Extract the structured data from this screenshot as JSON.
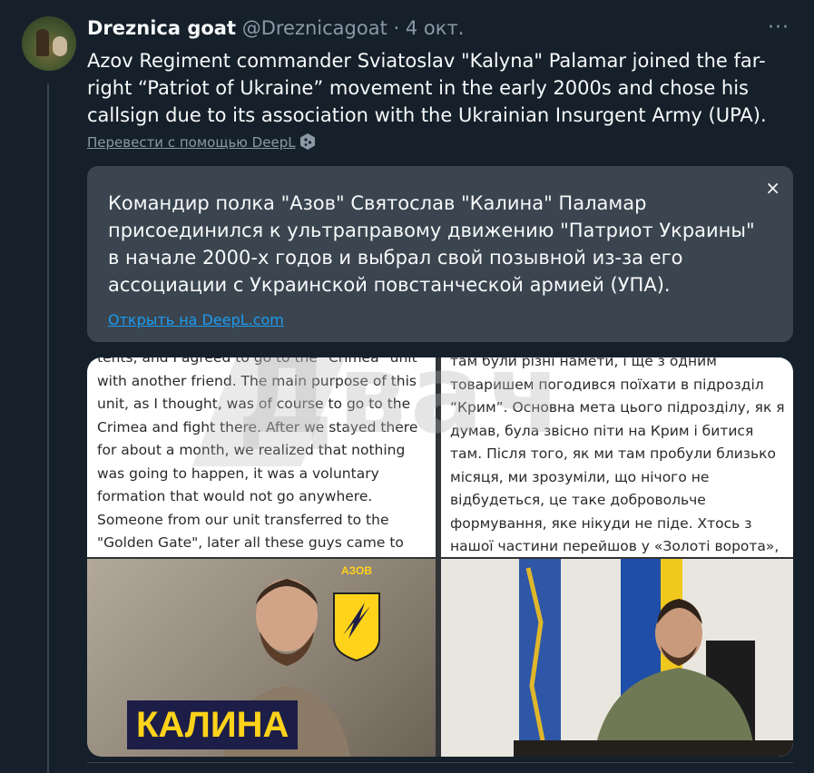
{
  "tweet": {
    "author_name": "Dreznica goat",
    "handle": "@Dreznicagoat",
    "separator": "·",
    "date": "4 окт.",
    "more_label": "···",
    "text": "Azov Regiment commander Sviatoslav \"Kalyna\" Palamar joined the far-right “Patriot of Ukraine” movement in the early 2000s and chose his callsign due to its association with the Ukrainian Insurgent Army (UPA).",
    "translate_label": "Перевести с помощью DeepL"
  },
  "translation": {
    "text": "Командир полка \"Азов\" Святослав \"Калина\" Паламар присоединился к ультраправому движению \"Патриот Украины\" в начале 2000-х годов и выбрал свой позывной из-за его ассоциации с Украинской повстанческой армией (УПА).",
    "close_label": "×",
    "open_label": "Открыть на DeepL.com"
  },
  "media": {
    "watermark": "Двач",
    "doc_en": "tents, and I agreed to go to the \"Crimea\" unit with another friend. The main purpose of this unit, as I thought, was of course to go to the Crimea and fight there. After we stayed there for about a month, we realized that nothing was going to happen, it was a voluntary formation that would not go anywhere. Someone from our unit transferred to the \"Golden Gate\", later all these guys came to Azov, and the others transferred to",
    "doc_uk": "там були різні намети, і ще з одним товаришем погодився поїхати в підрозділ “Крим”. Основна мета цього підрозділу, як я думав, була звісно піти на Крим і битися там. Після того, як ми там пробули близько місяця, ми зрозуміли, що нічого не відбудеться, це таке добровольче формування, яке нікуди не піде. Хтось з нашої частини перейшов у «Золоті ворота», пізніше всі ці хлопці прийшли в Азов, а інші перейшли",
    "badge_text": "АЗОВ",
    "banner_text": "КАЛИНА"
  },
  "colors": {
    "background": "#15202b",
    "link": "#1d9bf0",
    "muted": "#8b98a5",
    "translation_bg": "#3a4550",
    "banner_bg": "#1c1e47",
    "banner_text": "#ffd31a"
  }
}
